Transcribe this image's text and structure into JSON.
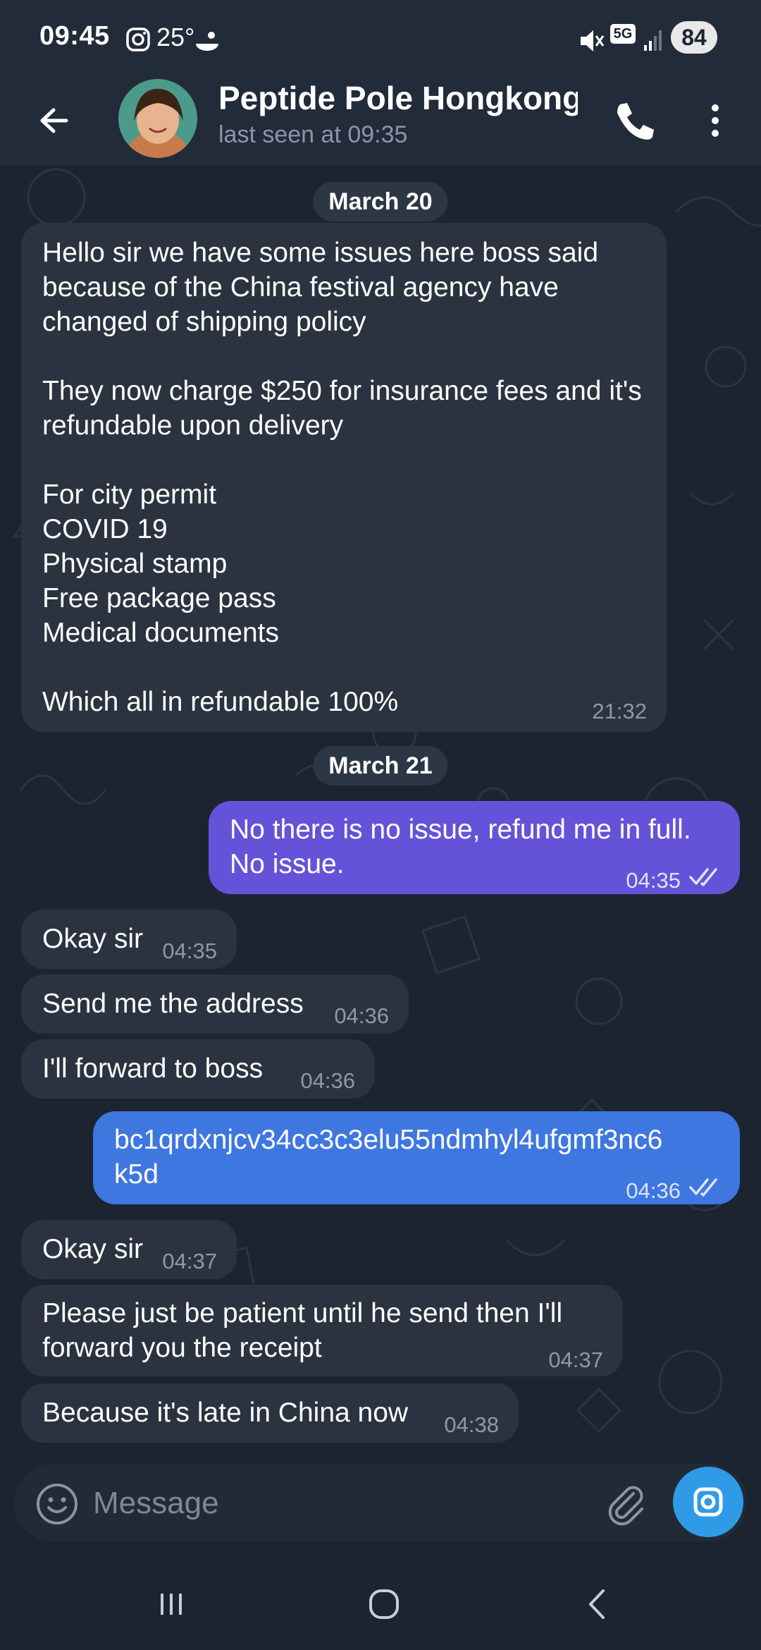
{
  "status_bar": {
    "time": "09:45",
    "temperature": "25°",
    "network": "5G",
    "battery": "84",
    "icons": [
      "instagram-icon",
      "weather-icon",
      "mute-icon",
      "5g-icon",
      "signal-icon",
      "battery-icon"
    ]
  },
  "header": {
    "contact_name": "Peptide Pole Hongkong",
    "last_seen": "last seen at 09:35",
    "icons": [
      "back-arrow-icon",
      "avatar",
      "phone-icon",
      "more-vertical-icon"
    ]
  },
  "conversation": {
    "date_1": "March 20",
    "date_2": "March 21",
    "messages": [
      {
        "direction": "in",
        "text": "Hello sir we have some issues here boss said because of the China festival agency have changed of shipping policy\n\nThey now charge $250 for insurance fees and it's refundable upon delivery\n\nFor city permit\nCOVID 19\nPhysical stamp\nFree package pass\nMedical documents\n\nWhich all in refundable 100%",
        "time": "21:32"
      },
      {
        "direction": "out",
        "text": "No there is no issue, refund me in full.\nNo issue.",
        "time": "04:35",
        "read": true
      },
      {
        "direction": "in",
        "text": "Okay sir",
        "time": "04:35"
      },
      {
        "direction": "in",
        "text": "Send me the address",
        "time": "04:36"
      },
      {
        "direction": "in",
        "text": "I'll forward to boss",
        "time": "04:36"
      },
      {
        "direction": "out",
        "text": "bc1qrdxnjcv34cc3c3elu55ndmhyl4ufgmf3nc6\nk5d",
        "time": "04:36",
        "read": true
      },
      {
        "direction": "in",
        "text": "Okay sir",
        "time": "04:37"
      },
      {
        "direction": "in",
        "text": "Please just be patient until he send then I'll\nforward you the receipt",
        "time": "04:37"
      },
      {
        "direction": "in",
        "text": "Because it's late in China now",
        "time": "04:38"
      }
    ]
  },
  "composer": {
    "placeholder": "Message",
    "icons": [
      "emoji-icon",
      "attach-icon",
      "camera-icon"
    ]
  },
  "nav_bar": {
    "icons": [
      "recents-icon",
      "home-icon",
      "back-icon"
    ]
  },
  "colors": {
    "background": "#1c2431",
    "incoming_bubble": "#2b3340",
    "outgoing_purple": "#6453d9",
    "outgoing_blue": "#3f77e0",
    "camera_button": "#2f9be6"
  }
}
